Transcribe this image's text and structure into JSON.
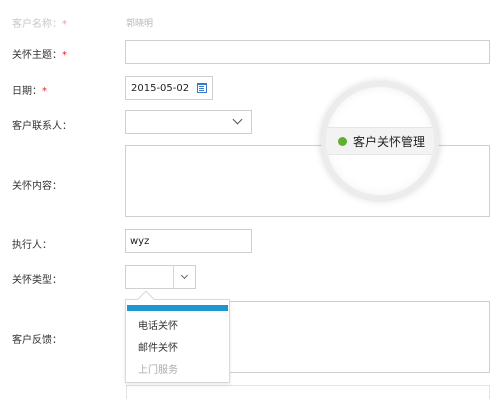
{
  "form": {
    "customer_name": {
      "label": "客户名称：",
      "required": "*",
      "value": "郭晓明"
    },
    "care_subject": {
      "label": "关怀主题：",
      "required": "*",
      "value": ""
    },
    "date": {
      "label": "日期：",
      "required": "*",
      "value": "2015-05-02"
    },
    "customer_contact": {
      "label": "客户联系人：",
      "value": ""
    },
    "care_content": {
      "label": "关怀内容：",
      "value": ""
    },
    "executor": {
      "label": "执行人：",
      "value": "wyz"
    },
    "care_type": {
      "label": "关怀类型：",
      "value": ""
    },
    "customer_feedback": {
      "label": "客户反馈：",
      "value": ""
    }
  },
  "care_type_dropdown": {
    "options": [
      "电话关怀",
      "邮件关怀",
      "上门服务"
    ]
  },
  "magnifier": {
    "label": "客户关怀管理",
    "dot_color": "#5fb030"
  },
  "colors": {
    "required": "#e0242b",
    "highlight": "#1e96d2",
    "calendar_icon": "#3a78c8"
  }
}
